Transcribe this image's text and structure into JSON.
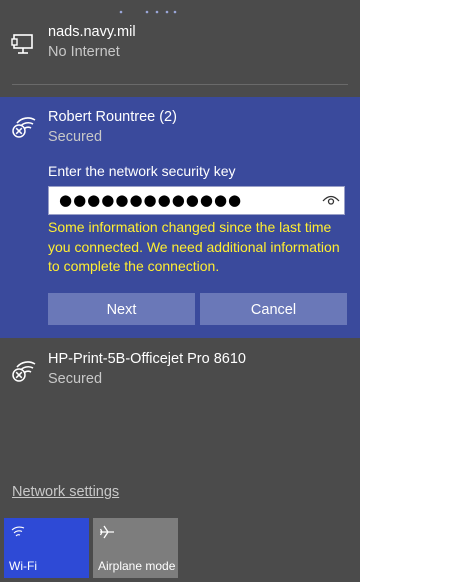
{
  "networks": [
    {
      "name": "nads.navy.mil",
      "status": "No Internet",
      "icon": "ethernet-icon"
    },
    {
      "name": "Robert Rountree (2)",
      "status": "Secured",
      "icon": "wifi-secured-icon"
    },
    {
      "name": "HP-Print-5B-Officejet Pro 8610",
      "status": "Secured",
      "icon": "wifi-secured-icon"
    }
  ],
  "connect_panel": {
    "key_label": "Enter the network security key",
    "key_value": "●●●●●●●●●●●●●",
    "warning": "Some information changed since the last time you connected. We need additional information to complete the connection.",
    "next_label": "Next",
    "cancel_label": "Cancel"
  },
  "footer": {
    "settings_link": "Network settings",
    "tiles": [
      {
        "label": "Wi-Fi",
        "icon": "wifi-icon",
        "active": true
      },
      {
        "label": "Airplane mode",
        "icon": "airplane-icon",
        "active": false
      }
    ]
  },
  "colors": {
    "flyout_bg": "#4b4b4b",
    "selected_bg": "#3a4a9c",
    "button_bg": "#6a78b8",
    "warning_text": "#ffee32",
    "wifi_tile_active": "#2e4ad6",
    "tile_inactive": "#7d7d7d"
  }
}
